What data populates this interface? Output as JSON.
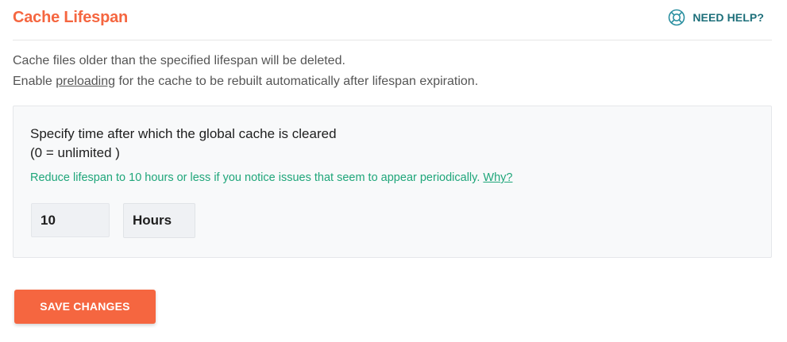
{
  "header": {
    "title": "Cache Lifespan",
    "help_label": "NEED HELP?",
    "help_icon": "lifebuoy-icon"
  },
  "description": {
    "line1": "Cache files older than the specified lifespan will be deleted.",
    "line2_before": "Enable ",
    "line2_link": "preloading",
    "line2_after": " for the cache to be rebuilt automatically after lifespan expiration."
  },
  "lifespan": {
    "label_line1": "Specify time after which the global cache is cleared",
    "label_line2": "(0 = unlimited )",
    "hint": "Reduce lifespan to 10 hours or less if you notice issues that seem to appear periodically.",
    "hint_link": "Why?",
    "value": "10",
    "unit": "Hours"
  },
  "actions": {
    "save_label": "SAVE CHANGES"
  },
  "colors": {
    "accent": "#f56640",
    "help": "#1d6f7a",
    "hint": "#1fa67a",
    "panel_bg": "#f8f9fa"
  }
}
